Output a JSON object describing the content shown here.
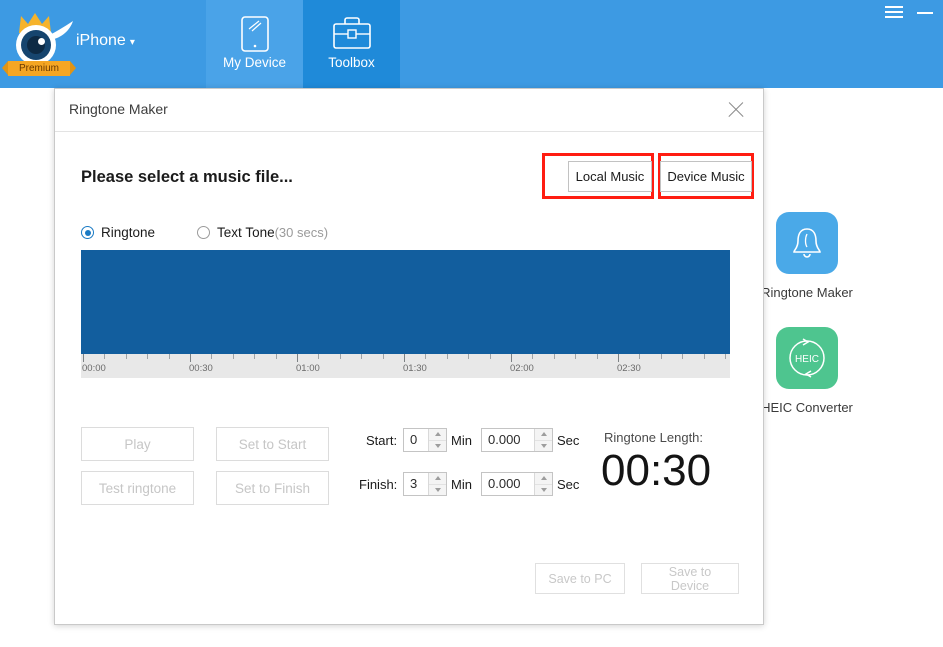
{
  "app": {
    "device_name": "iPhone",
    "device_caret": "▾",
    "premium_badge": "Premium",
    "tabs": [
      {
        "label": "My Device",
        "icon": "tablet-icon",
        "active": false
      },
      {
        "label": "Toolbox",
        "icon": "briefcase-icon",
        "active": true
      }
    ],
    "window_controls": [
      {
        "name": "menu-icon"
      },
      {
        "name": "minimize-icon"
      }
    ],
    "accent_color": "#3d9ae3",
    "active_tab_color": "#1f8ad9"
  },
  "tools": [
    {
      "label": "Ringtone Maker",
      "icon": "bell-icon",
      "color": "#4aa9e8"
    },
    {
      "label": "HEIC Converter",
      "icon": "heic-refresh-icon",
      "color": "#4ec58f",
      "icon_text": "HEIC"
    }
  ],
  "dialog": {
    "title": "Ringtone Maker",
    "close_label": "×",
    "prompt": "Please select a music file...",
    "source_buttons": [
      {
        "label": "Local Music",
        "highlighted": true
      },
      {
        "label": "Device Music",
        "highlighted": true
      }
    ],
    "highlight_color": "#ff1d11",
    "tone_options": [
      {
        "label": "Ringtone",
        "sub": "",
        "selected": true
      },
      {
        "label": "Text Tone",
        "sub": "(30 secs)",
        "selected": false
      }
    ],
    "waveform": {
      "color": "#125e9e",
      "ruler_bg": "#e8e8e8",
      "tick_labels": [
        "00:00",
        "00:30",
        "01:00",
        "01:30",
        "02:00",
        "02:30"
      ]
    },
    "controls": [
      {
        "label": "Play",
        "enabled": false
      },
      {
        "label": "Test ringtone",
        "enabled": false
      },
      {
        "label": "Set to Start",
        "enabled": false
      },
      {
        "label": "Set to Finish",
        "enabled": false
      }
    ],
    "time_fields": {
      "start_label": "Start:",
      "finish_label": "Finish:",
      "min_label": "Min",
      "sec_label": "Sec",
      "start_min": "0",
      "start_sec": "0.000",
      "finish_min": "3",
      "finish_sec": "0.000"
    },
    "length": {
      "label": "Ringtone Length:",
      "value": "00:30"
    },
    "save_buttons": [
      {
        "label": "Save to PC",
        "enabled": false
      },
      {
        "label": "Save to Device",
        "enabled": false
      }
    ]
  }
}
